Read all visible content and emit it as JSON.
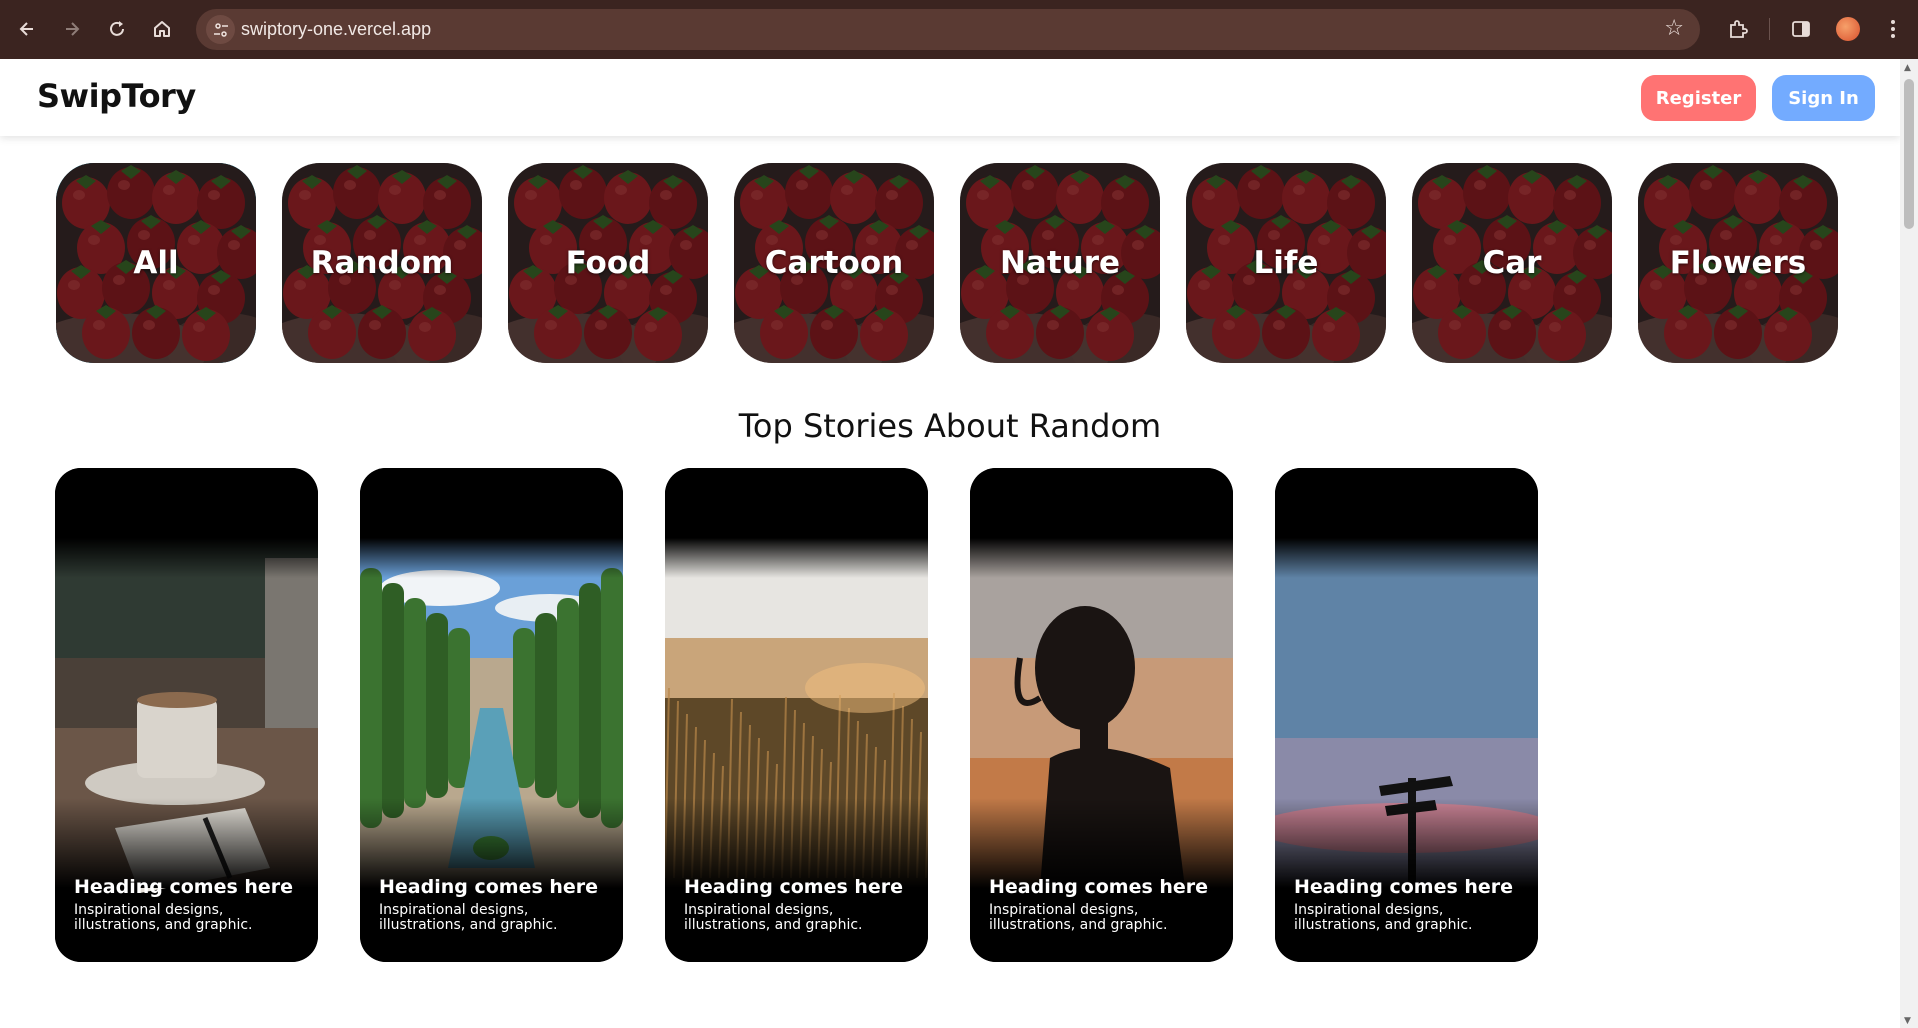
{
  "browser": {
    "url": "swiptory-one.vercel.app",
    "icons": {
      "back": "arrow-left-icon",
      "forward": "arrow-right-icon",
      "reload": "reload-icon",
      "home": "home-icon",
      "site_info": "tune-icon",
      "bookmark": "star-icon",
      "extensions": "puzzle-icon",
      "side_panel": "side-panel-icon",
      "menu": "kebab-menu-icon"
    }
  },
  "header": {
    "logo": "SwipTory",
    "register_label": "Register",
    "signin_label": "Sign In",
    "register_color": "#ff7373",
    "signin_color": "#73abff"
  },
  "categories": [
    {
      "label": "All",
      "selected": true
    },
    {
      "label": "Random",
      "selected": false
    },
    {
      "label": "Food",
      "selected": false
    },
    {
      "label": "Cartoon",
      "selected": false
    },
    {
      "label": "Nature",
      "selected": false
    },
    {
      "label": "Life",
      "selected": false
    },
    {
      "label": "Car",
      "selected": false
    },
    {
      "label": "Flowers",
      "selected": false
    }
  ],
  "section_title": "Top Stories About Random",
  "stories": [
    {
      "heading": "Heading comes here",
      "description": "Inspirational designs, illustrations, and graphic.",
      "image": "coffee-cup-notebook"
    },
    {
      "heading": "Heading comes here",
      "description": "Inspirational designs, illustrations, and graphic.",
      "image": "garden-cypress-fountain"
    },
    {
      "heading": "Heading comes here",
      "description": "Inspirational designs, illustrations, and graphic.",
      "image": "wheat-field-sunset"
    },
    {
      "heading": "Heading comes here",
      "description": "Inspirational designs, illustrations, and graphic.",
      "image": "silhouette-girl-sunset"
    },
    {
      "heading": "Heading comes here",
      "description": "Inspirational designs, illustrations, and graphic.",
      "image": "signpost-sky"
    }
  ],
  "colors": {
    "selected_outline": "#00acd6",
    "chrome_bg": "#3b2420"
  }
}
